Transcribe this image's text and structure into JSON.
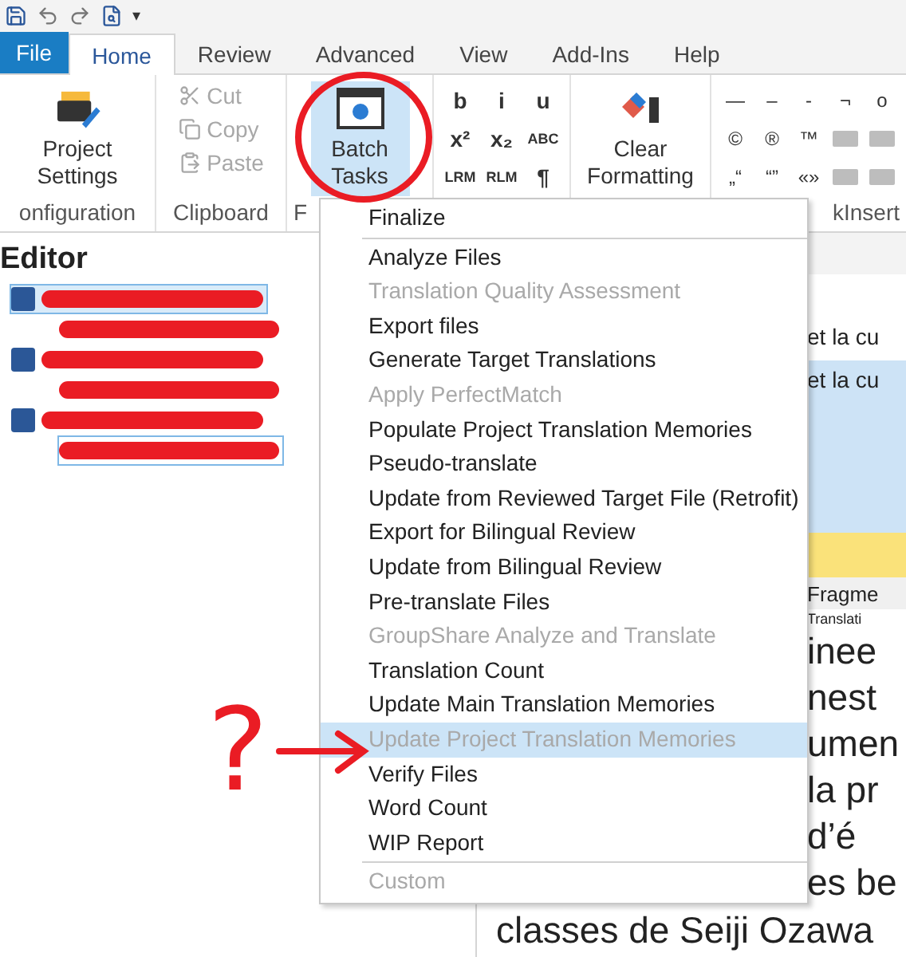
{
  "quick_access": {
    "menu_glyph": "▾"
  },
  "tabs": [
    {
      "label": "File",
      "kind": "file",
      "selected": false
    },
    {
      "label": "Home",
      "kind": "tab",
      "selected": true
    },
    {
      "label": "Review",
      "kind": "tab",
      "selected": false
    },
    {
      "label": "Advanced",
      "kind": "tab",
      "selected": false
    },
    {
      "label": "View",
      "kind": "tab",
      "selected": false
    },
    {
      "label": "Add-Ins",
      "kind": "tab",
      "selected": false
    },
    {
      "label": "Help",
      "kind": "tab",
      "selected": false
    }
  ],
  "ribbon": {
    "project_settings": {
      "label": "Project Settings",
      "group": "onfiguration"
    },
    "clipboard": {
      "group": "Clipboard",
      "items": [
        {
          "label": "Cut",
          "disabled": true
        },
        {
          "label": "Copy",
          "disabled": true
        },
        {
          "label": "Paste",
          "disabled": true
        }
      ]
    },
    "batch_tasks": {
      "label": "Batch Tasks",
      "group": "F",
      "pressed": true
    },
    "format_buttons": [
      "b",
      "i",
      "u",
      "x²",
      "x₂",
      "ABC",
      "LRM",
      "RLM",
      "¶"
    ],
    "clear_formatting": {
      "label": "Clear Formatting"
    },
    "symbols": [
      {
        "kind": "glyph",
        "text": "—"
      },
      {
        "kind": "glyph",
        "text": "–"
      },
      {
        "kind": "glyph",
        "text": "-"
      },
      {
        "kind": "glyph",
        "text": "¬"
      },
      {
        "kind": "glyph",
        "text": "o"
      },
      {
        "kind": "glyph",
        "text": "©"
      },
      {
        "kind": "glyph",
        "text": "®"
      },
      {
        "kind": "glyph",
        "text": "™"
      },
      {
        "kind": "tag"
      },
      {
        "kind": "tag"
      },
      {
        "kind": "glyph",
        "text": "„“"
      },
      {
        "kind": "glyph",
        "text": "“”"
      },
      {
        "kind": "glyph",
        "text": "«»"
      },
      {
        "kind": "tag"
      },
      {
        "kind": "tag"
      }
    ],
    "symbols_group": "kInsert"
  },
  "editor_pane": {
    "title": "Editor",
    "tree": [
      {
        "selected": true,
        "children": [
          {
            "selected": false
          }
        ]
      },
      {
        "selected": false,
        "children": [
          {
            "selected": false
          }
        ]
      },
      {
        "selected": false,
        "children": [
          {
            "selected": true
          }
        ]
      }
    ]
  },
  "editor": {
    "segments": [
      {
        "kind": "plain",
        "text": "et la cu"
      },
      {
        "kind": "active",
        "text": "et la cu"
      }
    ],
    "column_header": "Fragme",
    "subheader": "Translati",
    "lines": [
      "inee",
      "nest",
      "umen",
      "la pr",
      "d’é",
      "es be"
    ],
    "last_line": "classes de Seiji Ozawa"
  },
  "batch_menu": {
    "header": "Finalize",
    "items": [
      {
        "label": "Analyze Files",
        "disabled": false,
        "selected": false
      },
      {
        "label": "Translation Quality Assessment",
        "disabled": true,
        "selected": false
      },
      {
        "label": "Export files",
        "disabled": false,
        "selected": false
      },
      {
        "label": "Generate Target Translations",
        "disabled": false,
        "selected": false
      },
      {
        "label": "Apply PerfectMatch",
        "disabled": true,
        "selected": false
      },
      {
        "label": "Populate Project Translation Memories",
        "disabled": false,
        "selected": false
      },
      {
        "label": "Pseudo-translate",
        "disabled": false,
        "selected": false
      },
      {
        "label": "Update from Reviewed Target File (Retrofit)",
        "disabled": false,
        "selected": false
      },
      {
        "label": "Export for Bilingual Review",
        "disabled": false,
        "selected": false
      },
      {
        "label": "Update from Bilingual Review",
        "disabled": false,
        "selected": false
      },
      {
        "label": "Pre-translate Files",
        "disabled": false,
        "selected": false
      },
      {
        "label": "GroupShare Analyze and Translate",
        "disabled": true,
        "selected": false
      },
      {
        "label": "Translation Count",
        "disabled": false,
        "selected": false
      },
      {
        "label": "Update Main Translation Memories",
        "disabled": false,
        "selected": false
      },
      {
        "label": "Update Project Translation Memories",
        "disabled": true,
        "selected": true
      },
      {
        "label": "Verify Files",
        "disabled": false,
        "selected": false
      },
      {
        "label": "Word Count",
        "disabled": false,
        "selected": false
      },
      {
        "label": "WIP Report",
        "disabled": false,
        "selected": false
      }
    ],
    "footer": {
      "label": "Custom",
      "disabled": true
    }
  },
  "annotation": {
    "question": "?"
  }
}
